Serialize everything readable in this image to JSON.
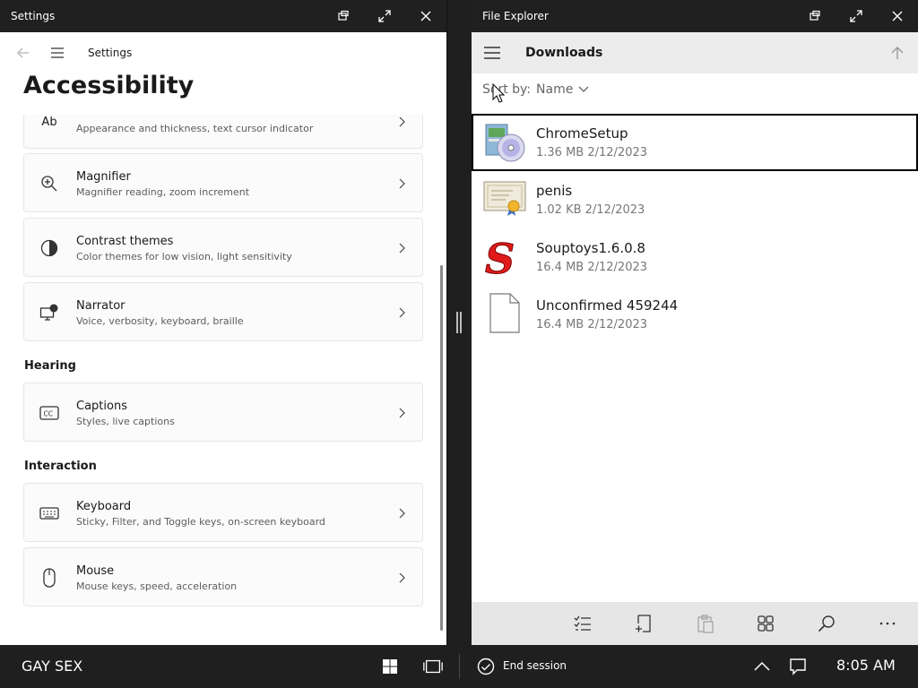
{
  "settings": {
    "window_title": "Settings",
    "nav_title": "Settings",
    "heading": "Accessibility",
    "cards_top": [
      {
        "icon": "text-cursor-icon",
        "title": "",
        "subtitle": "Appearance and thickness, text cursor indicator"
      },
      {
        "icon": "magnifier-icon",
        "title": "Magnifier",
        "subtitle": "Magnifier reading, zoom increment"
      },
      {
        "icon": "contrast-icon",
        "title": "Contrast themes",
        "subtitle": "Color themes for low vision, light sensitivity"
      },
      {
        "icon": "narrator-icon",
        "title": "Narrator",
        "subtitle": "Voice, verbosity, keyboard, braille"
      }
    ],
    "section_hearing": "Hearing",
    "captions": {
      "icon": "captions-icon",
      "title": "Captions",
      "subtitle": "Styles, live captions"
    },
    "section_interaction": "Interaction",
    "keyboard": {
      "icon": "keyboard-icon",
      "title": "Keyboard",
      "subtitle": "Sticky, Filter, and Toggle keys, on-screen keyboard"
    },
    "mouse": {
      "icon": "mouse-icon",
      "title": "Mouse",
      "subtitle": "Mouse keys, speed, acceleration"
    },
    "cursor_icon_text": "Ab"
  },
  "explorer": {
    "window_title": "File Explorer",
    "location": "Downloads",
    "sort_label": "Sort by:",
    "sort_value": "Name",
    "files": [
      {
        "name": "ChromeSetup",
        "meta": "1.36 MB 2/12/2023",
        "icon": "installer-disc-icon",
        "selected": true
      },
      {
        "name": "penis",
        "meta": "1.02 KB 2/12/2023",
        "icon": "certificate-icon",
        "selected": false
      },
      {
        "name": "Souptoys1.6.0.8",
        "meta": "16.4 MB 2/12/2023",
        "icon": "souptoys-s-icon",
        "selected": false
      },
      {
        "name": "Unconfirmed 459244",
        "meta": "16.4 MB 2/12/2023",
        "icon": "blank-file-icon",
        "selected": false
      }
    ]
  },
  "taskbar": {
    "label": "GAY SEX",
    "end_session": "End session",
    "time": "8:05 AM"
  },
  "colors": {
    "titlebar": "#202020",
    "taskbar": "#1f1f1f",
    "card_bg": "#fbfbfb",
    "explorer_nav": "#ececec",
    "command_bar": "#e6e6e6"
  }
}
